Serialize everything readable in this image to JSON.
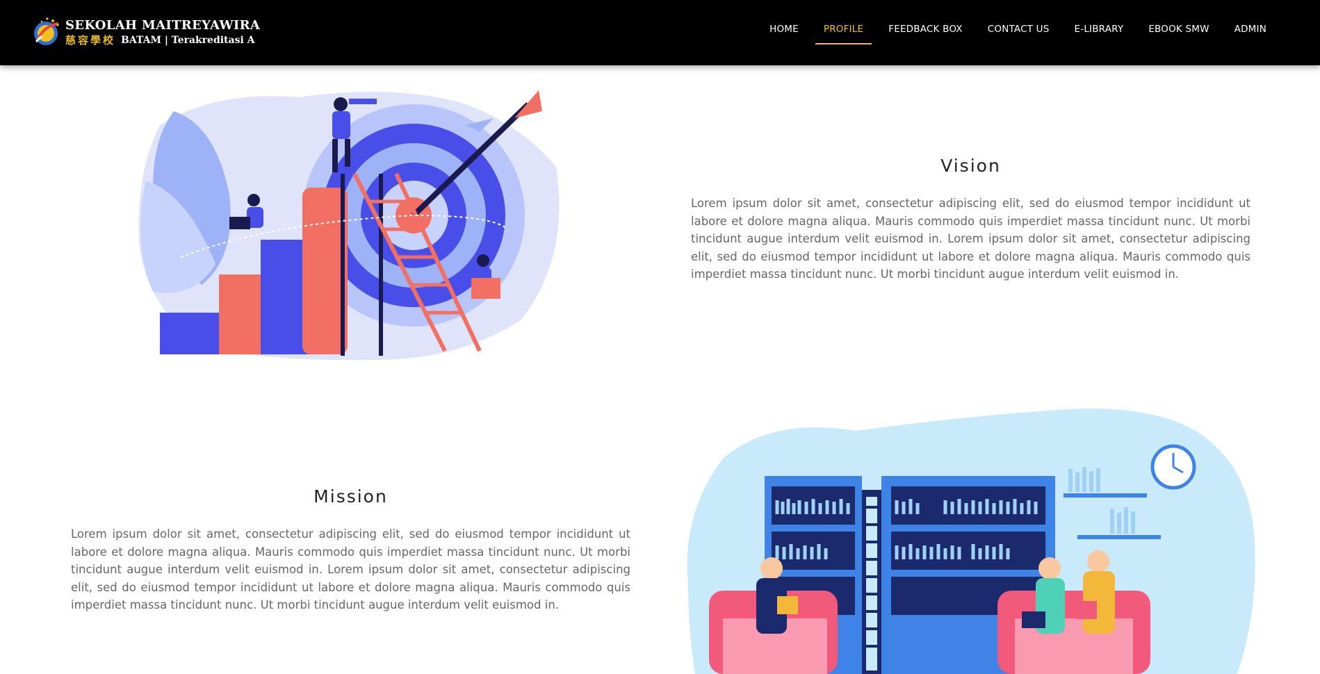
{
  "brand": {
    "name_line1": "SEKOLAH MAITREYAWIRA",
    "chinese_name": "慈容學校",
    "name_line2": "BATAM | Terakreditasi A"
  },
  "nav": {
    "items": [
      {
        "label": "HOME"
      },
      {
        "label": "PROFILE",
        "active": true
      },
      {
        "label": "FEEDBACK BOX"
      },
      {
        "label": "CONTACT US"
      },
      {
        "label": "E-LIBRARY"
      },
      {
        "label": "EBOOK SMW"
      },
      {
        "label": "ADMIN"
      }
    ]
  },
  "vision": {
    "title": "Vision",
    "text": "Lorem ipsum dolor sit amet, consectetur adipiscing elit, sed do eiusmod tempor incididunt ut labore et dolore magna aliqua. Mauris commodo quis imperdiet massa tincidunt nunc. Ut morbi tincidunt augue interdum velit euismod in. Lorem ipsum dolor sit amet, consectetur adipiscing elit, sed do eiusmod tempor incididunt ut labore et dolore magna aliqua. Mauris commodo quis imperdiet massa tincidunt nunc. Ut morbi tincidunt augue interdum velit euismod in."
  },
  "mission": {
    "title": "Mission",
    "text": "Lorem ipsum dolor sit amet, consectetur adipiscing elit, sed do eiusmod tempor incididunt ut labore et dolore magna aliqua. Mauris commodo quis imperdiet massa tincidunt nunc. Ut morbi tincidunt augue interdum velit euismod in. Lorem ipsum dolor sit amet, consectetur adipiscing elit, sed do eiusmod tempor incididunt ut labore et dolore magna aliqua. Mauris commodo quis imperdiet massa tincidunt nunc. Ut morbi tincidunt augue interdum velit euismod in."
  },
  "colors": {
    "nav_active": "#f2c31a",
    "header_bg": "#000000",
    "illustration_blue": "#4a4ee8",
    "illustration_coral": "#f26f63",
    "library_bg": "#c9eafb"
  }
}
